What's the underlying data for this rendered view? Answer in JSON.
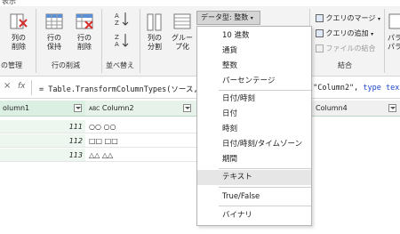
{
  "window": {
    "top_label": "表示"
  },
  "ribbon": {
    "col_remove": "列の",
    "col_remove2": "削除",
    "row_keep": "行の",
    "row_keep2": "保持",
    "row_remove": "行の",
    "row_remove2": "削除",
    "col_split": "列の",
    "col_split2": "分割",
    "group_by": "グルー",
    "group_by2": "プ化",
    "group_manage": "の管理",
    "group_row_reduce": "行の削減",
    "group_sort": "並べ替え",
    "group_combine": "結合",
    "datatype_label": "データ型: 整数",
    "merge_queries": "クエリのマージ",
    "append_queries": "クエリの追加",
    "combine_files": "ファイルの結合",
    "param_right": "パラ",
    "param_right2": "パラ"
  },
  "formula_bar": {
    "formula_left": "= Table.TransformColumnTypes(ソース,",
    "formula_right_str": "{\"Column2\",",
    "formula_right_kw": "type tex"
  },
  "grid": {
    "columns": [
      "olumn1",
      "Column2",
      "Column4"
    ],
    "col2_type_icon": "ABC",
    "rows": [
      {
        "c1": "111",
        "c2": "○○ ○○"
      },
      {
        "c1": "112",
        "c2": "□□ □□"
      },
      {
        "c1": "113",
        "c2": "△△ △△"
      }
    ]
  },
  "datatype_menu": {
    "items": [
      "10 進数",
      "通貨",
      "整数",
      "パーセンテージ",
      "日付/時刻",
      "日付",
      "時刻",
      "日付/時刻/タイムゾーン",
      "期間",
      "テキスト",
      "True/False",
      "バイナリ"
    ],
    "selected": "テキスト"
  },
  "colors": {
    "accent_green": "#dcefe3",
    "keyword_blue": "#1a47c9"
  }
}
